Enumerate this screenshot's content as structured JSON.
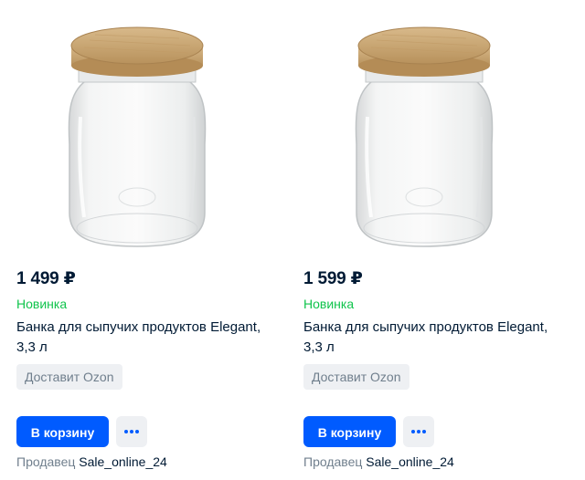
{
  "products": [
    {
      "price": "1 499 ₽",
      "badge": "Новинка",
      "title": "Банка для сыпучих продуктов Elegant, 3,3 л",
      "delivery": "Доставит Ozon",
      "cart_label": "В корзину",
      "seller_label": "Продавец",
      "seller_name": "Sale_online_24",
      "image": "glass-jar-with-bamboo-lid",
      "favorite_icon": "heart-outline-icon"
    },
    {
      "price": "1 599 ₽",
      "badge": "Новинка",
      "title": "Банка для сыпучих продуктов Elegant, 3,3 л",
      "delivery": "Доставит Ozon",
      "cart_label": "В корзину",
      "seller_label": "Продавец",
      "seller_name": "Sale_online_24",
      "image": "glass-jar-with-bamboo-lid",
      "favorite_icon": "heart-outline-icon"
    }
  ],
  "colors": {
    "accent": "#005bff",
    "new_badge": "#10c44c",
    "muted": "#707f8d",
    "chip_bg": "#eef0f3",
    "text": "#001a34"
  }
}
